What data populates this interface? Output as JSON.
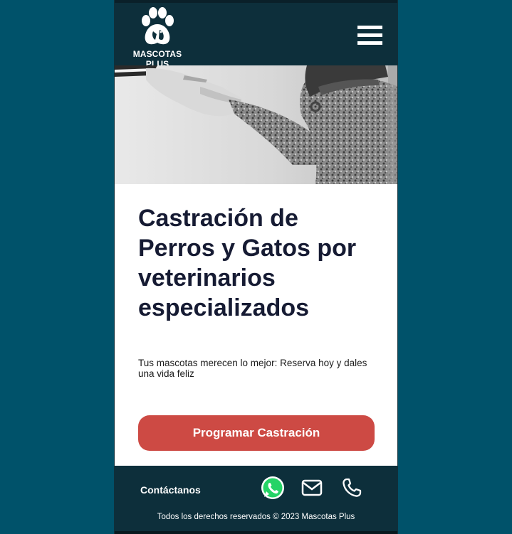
{
  "brand": {
    "name": "MASCOTAS PLUS"
  },
  "hero": {
    "image_alt": "Mano humana sosteniendo la pata de un perro"
  },
  "main": {
    "title": "Castración de Perros y Gatos por veterinarios especializados",
    "subtitle": "Tus mascotas merecen lo mejor: Reserva hoy y dales una vida feliz",
    "cta_label": "Programar Castración"
  },
  "footer": {
    "contact_label": "Contáctanos",
    "copyright": "Todos los derechos reservados © 2023 Mascotas Plus",
    "icons": [
      "whatsapp-icon",
      "mail-icon",
      "phone-icon"
    ]
  },
  "colors": {
    "page_bg": "#00526a",
    "header_bg": "#0d2f3b",
    "accent": "#cd4a44",
    "whatsapp": "#25d366",
    "title_text": "#161b33"
  }
}
